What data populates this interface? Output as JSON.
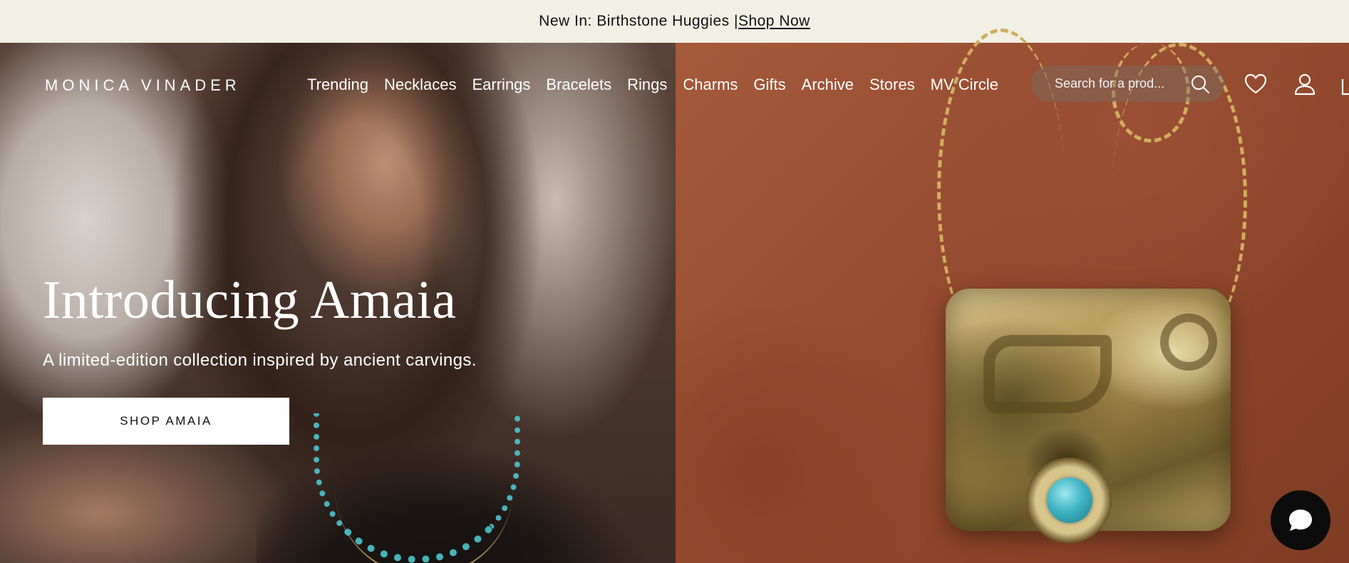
{
  "announcement": {
    "text": "New In: Birthstone Huggies | ",
    "link": "Shop Now"
  },
  "header": {
    "logo": "MONICA VINADER",
    "nav": [
      "Trending",
      "Necklaces",
      "Earrings",
      "Bracelets",
      "Rings",
      "Charms",
      "Gifts",
      "Archive",
      "Stores",
      "MV Circle"
    ],
    "search_placeholder": "Search for a prod..."
  },
  "hero": {
    "title": "Introducing Amaia",
    "subtitle": "A limited-edition collection inspired by ancient carvings.",
    "cta": "SHOP AMAIA"
  },
  "icons": {
    "search": "search-icon",
    "wishlist": "heart-icon",
    "account": "user-icon",
    "bag": "bag-icon",
    "chat": "chat-bubble-icon"
  },
  "colors": {
    "announcement_bg": "#f2efe4",
    "chat_button": "#0c0c0c",
    "cta_bg": "#ffffff"
  }
}
